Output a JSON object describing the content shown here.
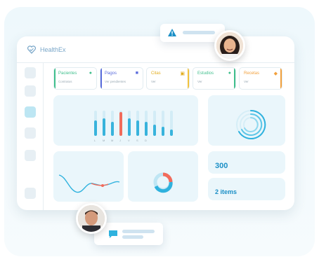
{
  "app": {
    "logo_text": "HealthEx"
  },
  "colors": {
    "accent_blue": "#1b8fc6",
    "bar_blue": "#38b3dc",
    "bar_red": "#f26b5b",
    "green": "#3fbf8c",
    "purple": "#5b6cdc",
    "yellow": "#f2c23c",
    "orange": "#f2a03c"
  },
  "stats": [
    {
      "title": "Pacientes",
      "subtitle": "Contratos",
      "color": "#3fbf8c",
      "icon": "user-icon"
    },
    {
      "title": "Pagos",
      "subtitle": "Ver pendientes",
      "color": "#5b6cdc",
      "icon": "wallet-icon"
    },
    {
      "title": "Citas",
      "subtitle": "Ver",
      "color": "#f2c23c",
      "icon": "calendar-icon"
    },
    {
      "title": "Estudios",
      "subtitle": "Ver",
      "color": "#3fbf8c",
      "icon": "flask-icon"
    },
    {
      "title": "Recetas",
      "subtitle": "Ver",
      "color": "#f2a03c",
      "icon": "pill-icon"
    }
  ],
  "bars_card": {
    "title": ""
  },
  "chart_data": {
    "type": "bar",
    "categories": [
      "L",
      "M",
      "M",
      "J",
      "V",
      "S",
      "D",
      "",
      "",
      ""
    ],
    "values": [
      0.6,
      0.7,
      0.55,
      0.95,
      0.7,
      0.6,
      0.55,
      0.45,
      0.35,
      0.25
    ],
    "highlight_index": 3
  },
  "radial_card": {
    "title": ""
  },
  "line_card": {
    "title": ""
  },
  "donut_card": {
    "title": ""
  },
  "metric_1": {
    "label": "",
    "value": "300"
  },
  "metric_2": {
    "label": "",
    "value": "2 items"
  },
  "progress": {
    "fill_fraction": 0.85
  }
}
